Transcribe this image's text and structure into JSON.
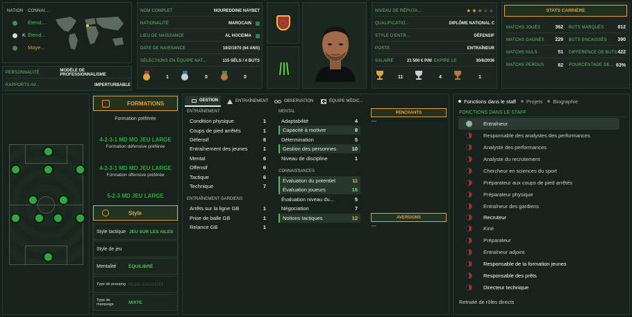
{
  "nation_panel": {
    "col_nation": "NATION",
    "col_knowledge": "CONNAI...",
    "rows": [
      {
        "label": "Étend..."
      },
      {
        "prefix": "K",
        "label": "Étend..."
      },
      {
        "label": "Moye..."
      }
    ]
  },
  "personality": {
    "label": "PERSONNALITÉ",
    "value": "MODÈLE DE PROFESSIONNALISME"
  },
  "media": {
    "label": "RAPPORTS AV...",
    "value": "IMPERTURBABLE"
  },
  "bio": {
    "full_name": {
      "label": "NOM COMPLET",
      "value": "NOUREDDINE NAYBET"
    },
    "nationality": {
      "label": "NATIONALITÉ",
      "value": "MAROCAIN"
    },
    "birthplace": {
      "label": "LIEU DE NAISSANCE",
      "value": "AL HOCEIMA"
    },
    "birthdate": {
      "label": "DATE DE NAISSANCE",
      "value": "10/2/1970 (64 ANS)"
    },
    "caps": {
      "label": "SÉLECTIONS EN ÉQUIPE NAT...",
      "value": "115 SÉLS / 4 BUTS"
    },
    "medals": [
      "1",
      "0",
      "0"
    ]
  },
  "reputation": {
    "label": "NIVEAU DE RÉPUTA...",
    "stars": 2.5,
    "qualification": {
      "label": "QUALIFICATIO...",
      "value": "DIPLÔME NATIONAL C"
    },
    "style": {
      "label": "STYLE D'ENTR...",
      "value": "DÉFENSIF"
    },
    "post": {
      "label": "POSTE",
      "value": "ENTRAÎNEUR"
    },
    "salary": {
      "label": "SALAIRE",
      "amount": "21 500 € P/M",
      "expires_label": "EXPIRE LE",
      "expires": "30/6/2036"
    },
    "trophies": [
      "11",
      "4",
      "1"
    ]
  },
  "career": {
    "title": "STATS CARRIÈRE",
    "left": [
      {
        "label": "MATCHS JOUÉS",
        "value": "362"
      },
      {
        "label": "MATCHS GAGNÉS",
        "value": "229"
      },
      {
        "label": "MATCHS NULS",
        "value": "51"
      },
      {
        "label": "MATCHS PERDUS",
        "value": "82"
      }
    ],
    "right": [
      {
        "label": "BUTS MARQUÉS",
        "value": "812"
      },
      {
        "label": "BUTS ENCAISSÉS",
        "value": "390"
      },
      {
        "label": "DIFFÉRENCE DE BUTS",
        "value": "422"
      },
      {
        "label": "POURCENTAGE DE...",
        "value": "63%"
      }
    ]
  },
  "formations": {
    "title": "FORMATIONS",
    "preferred_label": "Formation préférée",
    "items": [
      {
        "name": "4-2-3-1 MD MO JEU LARGE",
        "caption": "Formation défensive préférée"
      },
      {
        "name": "4-2-3-1 MD MO JEU LARGE",
        "caption": "Formation offensive préférée"
      },
      {
        "name": "5-2-3 MD JEU LARGE",
        "caption": ""
      }
    ]
  },
  "style_panel": {
    "title": "Style",
    "rows": [
      {
        "label": "Style tactique",
        "value": "JEU SUR LES AILES"
      },
      {
        "label": "Style de jeu",
        "value": ""
      },
      {
        "label": "Mentalité",
        "value": "ÉQUILIBRÉ"
      },
      {
        "label": "Type de pressing",
        "value": "PLUS SOUVENT"
      },
      {
        "label": "Type de marquage",
        "value": "MIXTE"
      }
    ]
  },
  "tabs": [
    "GESTION",
    "ENTRAÎNEMENT",
    "OBSERVATION",
    "ÉQUIPE MÉDIC..."
  ],
  "attributes": {
    "training_title": "ENTRAÎNEMENT",
    "training": [
      {
        "name": "Condition physique",
        "value": "1"
      },
      {
        "name": "Coups de pied arrêtés",
        "value": "1"
      },
      {
        "name": "Défensif",
        "value": "8"
      },
      {
        "name": "Entraînement des jeunes",
        "value": "1"
      },
      {
        "name": "Mental",
        "value": "6"
      },
      {
        "name": "Offensif",
        "value": "6"
      },
      {
        "name": "Tactique",
        "value": "6"
      },
      {
        "name": "Technique",
        "value": "7"
      }
    ],
    "gk_title": "ENTRAÎNEMENT GARDIENS",
    "gk": [
      {
        "name": "Arrêts sur la ligne GB",
        "value": "1"
      },
      {
        "name": "Prise de balle GB",
        "value": "1"
      },
      {
        "name": "Relance GB",
        "value": "1"
      }
    ],
    "mental_title": "MENTAL",
    "mental": [
      {
        "name": "Adaptabilité",
        "value": "4"
      },
      {
        "name": "Capacité à motiver",
        "value": "8"
      },
      {
        "name": "Détermination",
        "value": "5"
      },
      {
        "name": "Gestion des personnes",
        "value": "10"
      },
      {
        "name": "Niveau de discipline",
        "value": "1"
      }
    ],
    "knowledge_title": "CONNAISSANCES",
    "knowledge": [
      {
        "name": "Évaluation du potentiel",
        "value": "11"
      },
      {
        "name": "Évaluation joueurs",
        "value": "16"
      },
      {
        "name": "Évaluation niveau du...",
        "value": "5"
      },
      {
        "name": "Négociation",
        "value": "7"
      },
      {
        "name": "Notions tactiques",
        "value": "12"
      }
    ]
  },
  "penchants": {
    "title": "PENCHANTS",
    "value": "---"
  },
  "aversions": {
    "title": "AVERSIONS",
    "value": "---"
  },
  "staff_tabs": [
    "Fonctions dans le staff",
    "Projets",
    "Biographie"
  ],
  "staff": {
    "title": "FONCTIONS DANS LE STAFF",
    "roles": [
      "Entraîneur",
      "Responsable des analystes des performances",
      "Analyste des performances",
      "Analyste du recrutement",
      "Chercheur en sciences du sport",
      "Préparateur aux coups de pied arrêtés",
      "Préparateur physique",
      "Entraîneur des gardiens",
      "Recruteur",
      "Kiné",
      "Préparateur",
      "Entraîneur adjoint",
      "Responsable de la formation jeunes",
      "Responsable des prêts",
      "Directeur technique"
    ],
    "footer": "Retraité de rôles directs"
  }
}
